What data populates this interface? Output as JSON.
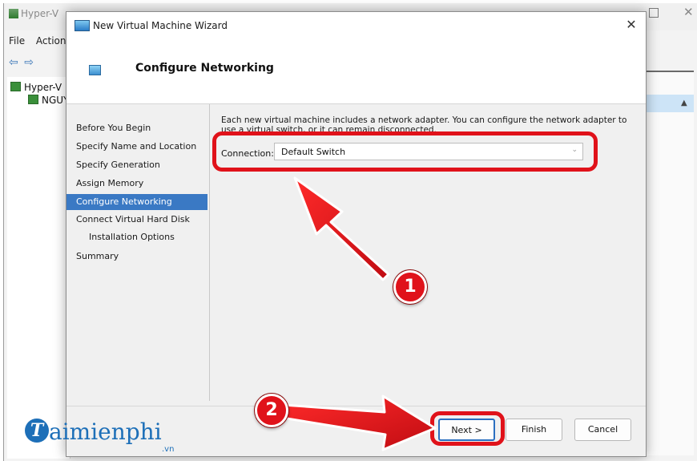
{
  "background_window": {
    "title": "Hyper-V",
    "menu": [
      "File",
      "Action"
    ],
    "tree": {
      "root": "Hyper-V",
      "child": "NGUY"
    }
  },
  "wizard": {
    "title": "New Virtual Machine Wizard",
    "close_glyph": "✕",
    "header_title": "Configure Networking",
    "nav": [
      "Before You Begin",
      "Specify Name and Location",
      "Specify Generation",
      "Assign Memory",
      "Configure Networking",
      "Connect Virtual Hard Disk",
      "Installation Options",
      "Summary"
    ],
    "selected_nav_index": 4,
    "description": "Each new virtual machine includes a network adapter. You can configure the network adapter to use a virtual switch, or it can remain disconnected.",
    "connection_label": "Connection:",
    "connection_value": "Default Switch",
    "buttons": {
      "next": "Next >",
      "finish": "Finish",
      "cancel": "Cancel"
    }
  },
  "annotations": {
    "step1": "1",
    "step2": "2",
    "color": "#e0121a"
  },
  "watermark": {
    "brand": "aimienphi",
    "logo_letter": "T",
    "suffix": ".vn"
  }
}
